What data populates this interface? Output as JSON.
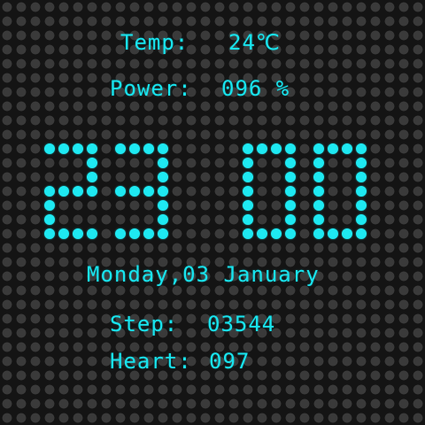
{
  "temp": {
    "label": "Temp:",
    "value": "24℃"
  },
  "power": {
    "label": "Power:",
    "value": "096 %"
  },
  "time": {
    "text": "2300",
    "digits": [
      "2",
      "3",
      "0",
      "0"
    ]
  },
  "date": {
    "text": "Monday,03 January"
  },
  "step": {
    "label": "Step:",
    "value": "03544"
  },
  "heart": {
    "label": "Heart:",
    "value": "097"
  },
  "colors": {
    "accent": "#18e4ee",
    "background": "#141414",
    "dot_off": "#3a3a3a"
  }
}
